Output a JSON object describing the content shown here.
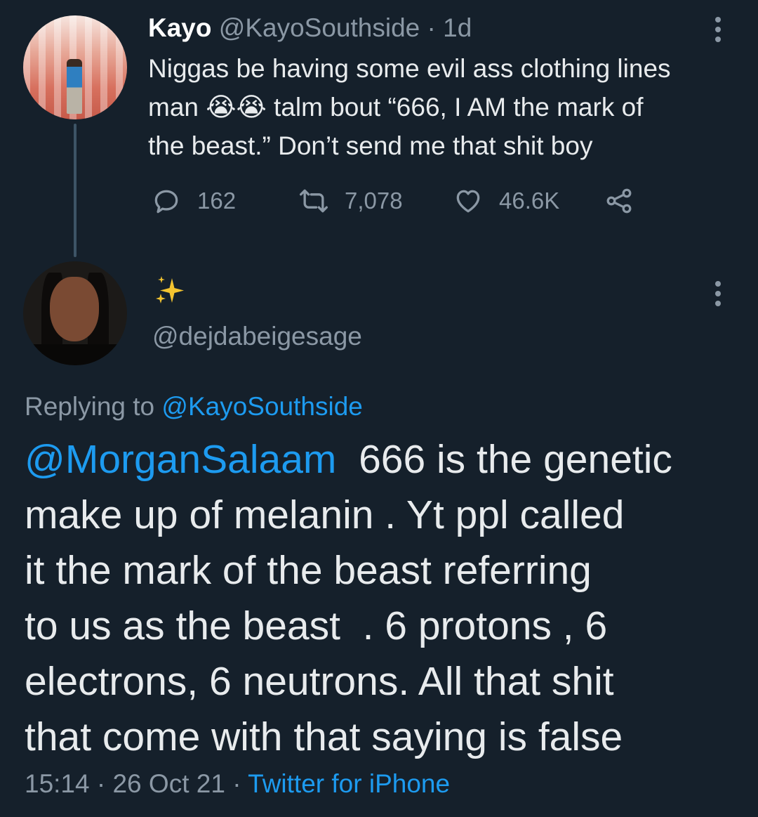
{
  "parent": {
    "name": "Kayo",
    "handle": "@KayoSouthside",
    "separator": "·",
    "time": "1d",
    "text_line1": "Niggas be having some evil ass clothing lines",
    "text_line2_start": "man ",
    "emoji": "😭😭",
    "text_line2_end": " talm bout “666, I AM the mark of",
    "text_line3": "the beast.” Don’t send me that shit boy",
    "replies": "162",
    "retweets": "7,078",
    "likes": "46.6K"
  },
  "reply": {
    "display_name": "✨",
    "handle": "@dejdabeigesage",
    "replying_label": "Replying to ",
    "replying_to": "@KayoSouthside",
    "mention": "@MorganSalaam",
    "lines": [
      "  666 is the genetic",
      "make up of melanin . Yt ppl called",
      "it the mark of the beast referring",
      "to us as the beast  . 6 protons , 6",
      "electrons, 6 neutrons. All that shit",
      "that come with that saying is false"
    ],
    "time": "15:14",
    "separator": "·",
    "date": "26 Oct 21",
    "separator2": "·",
    "source": "Twitter for iPhone"
  },
  "colors": {
    "background": "#15202b",
    "link": "#1d9bf0",
    "secondary_text": "#8b98a5"
  },
  "icons": [
    "reply-icon",
    "retweet-icon",
    "like-icon",
    "share-icon",
    "more-icon",
    "sparkle-icon"
  ]
}
